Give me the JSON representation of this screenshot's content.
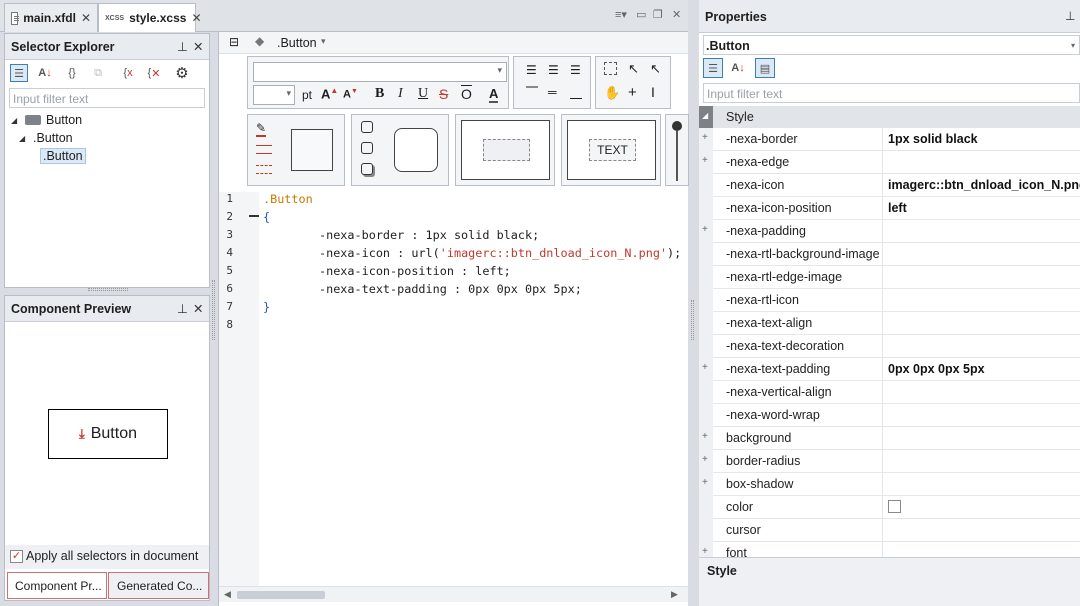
{
  "tabs": [
    {
      "label": "main.xfdl",
      "close": "✕"
    },
    {
      "label": "style.xcss",
      "close": "✕",
      "icon_text": "XCSS"
    }
  ],
  "selector_explorer": {
    "title": "Selector Explorer",
    "filter_placeholder": "Input filter text",
    "tree": [
      {
        "label": "Button",
        "level": 0
      },
      {
        "label": ".Button",
        "level": 1
      },
      {
        "label": ".Button",
        "level": 2,
        "selected": true
      }
    ]
  },
  "component_preview": {
    "title": "Component Preview",
    "button_label": "Button",
    "apply_all_label": "Apply all selectors in document",
    "apply_all_checked": true,
    "bottom_tabs": [
      "Component Pr...",
      "Generated Co..."
    ]
  },
  "editor": {
    "breadcrumb": ".Button",
    "font_unit": "pt",
    "text_sample": "TEXT",
    "lines": [
      {
        "n": "1",
        "text": ".Button"
      },
      {
        "n": "2",
        "text": "{"
      },
      {
        "n": "3",
        "prop": "-nexa-border",
        "sep": " : ",
        "value": "1px solid black;"
      },
      {
        "n": "4",
        "prop": "-nexa-icon",
        "sep": " : ",
        "value_pre": "url(",
        "value_str": "'imagerc::btn_dnload_icon_N.png'",
        "value_post": ");"
      },
      {
        "n": "5",
        "prop": "-nexa-icon-position",
        "sep": " : ",
        "value": "left;"
      },
      {
        "n": "6",
        "prop": "-nexa-text-padding",
        "sep": " : ",
        "value": "0px 0px 0px 5px;"
      },
      {
        "n": "7",
        "text": "}"
      },
      {
        "n": "8",
        "text": ""
      }
    ]
  },
  "properties": {
    "title": "Properties",
    "selector": ".Button",
    "filter_placeholder": "Input filter text",
    "category": "Style",
    "footer_label": "Style",
    "rows": [
      {
        "name": "-nexa-border",
        "value": "1px solid black",
        "expandable": true
      },
      {
        "name": "-nexa-edge",
        "value": "",
        "expandable": true
      },
      {
        "name": "-nexa-icon",
        "value": "imagerc::btn_dnload_icon_N.png",
        "expandable": false
      },
      {
        "name": "-nexa-icon-position",
        "value": "left",
        "expandable": false
      },
      {
        "name": "-nexa-padding",
        "value": "",
        "expandable": true
      },
      {
        "name": "-nexa-rtl-background-image",
        "value": "",
        "expandable": false
      },
      {
        "name": "-nexa-rtl-edge-image",
        "value": "",
        "expandable": false
      },
      {
        "name": "-nexa-rtl-icon",
        "value": "",
        "expandable": false
      },
      {
        "name": "-nexa-text-align",
        "value": "",
        "expandable": false
      },
      {
        "name": "-nexa-text-decoration",
        "value": "",
        "expandable": false
      },
      {
        "name": "-nexa-text-padding",
        "value": "0px 0px 0px 5px",
        "expandable": true
      },
      {
        "name": "-nexa-vertical-align",
        "value": "",
        "expandable": false
      },
      {
        "name": "-nexa-word-wrap",
        "value": "",
        "expandable": false
      },
      {
        "name": "background",
        "value": "",
        "expandable": true
      },
      {
        "name": "border-radius",
        "value": "",
        "expandable": true
      },
      {
        "name": "box-shadow",
        "value": "",
        "expandable": true
      },
      {
        "name": "color",
        "value": "",
        "expandable": false,
        "checkbox": true
      },
      {
        "name": "cursor",
        "value": "",
        "expandable": false
      },
      {
        "name": "font",
        "value": "",
        "expandable": true
      }
    ]
  },
  "colors": {
    "accent": "#3c7fb1",
    "selected_bg": "#dbe9f7",
    "code_selector": "#c47a00",
    "code_bracket": "#2856b8",
    "code_string": "#c0392b"
  }
}
